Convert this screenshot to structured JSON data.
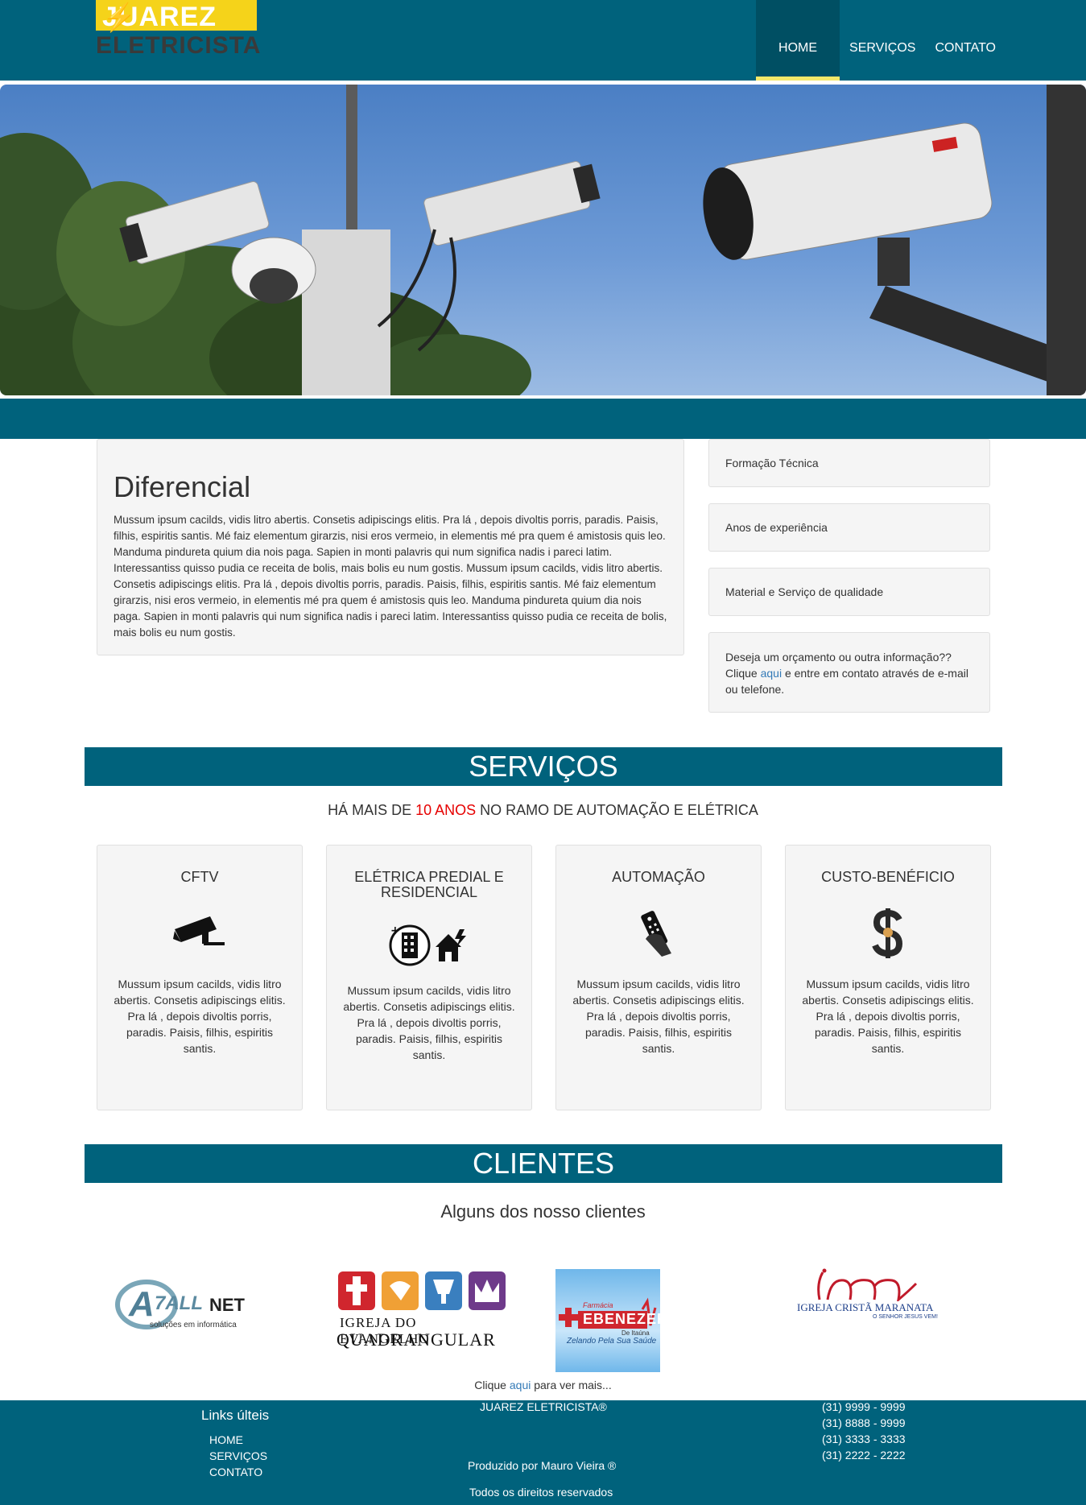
{
  "header": {
    "logo_top": "JUAREZ",
    "logo_bottom": "ELETRICISTA",
    "nav": [
      "HOME",
      "SERVIÇOS",
      "CONTATO"
    ]
  },
  "diferencial": {
    "title": "Diferencial",
    "text": "Mussum ipsum cacilds, vidis litro abertis. Consetis adipiscings elitis. Pra lá , depois divoltis porris, paradis. Paisis, filhis, espiritis santis. Mé faiz elementum girarzis, nisi eros vermeio, in elementis mé pra quem é amistosis quis leo. Manduma pindureta quium dia nois paga. Sapien in monti palavris qui num significa nadis i pareci latim. Interessantiss quisso pudia ce receita de bolis, mais bolis eu num gostis. Mussum ipsum cacilds, vidis litro abertis. Consetis adipiscings elitis. Pra lá , depois divoltis porris, paradis. Paisis, filhis, espiritis santis. Mé faiz elementum girarzis, nisi eros vermeio, in elementis mé pra quem é amistosis quis leo. Manduma pindureta quium dia nois paga. Sapien in monti palavris qui num significa nadis i pareci latim. Interessantiss quisso pudia ce receita de bolis, mais bolis eu num gostis."
  },
  "side": {
    "items": [
      "Formação Técnica",
      "Anos de experiência",
      "Material e Serviço de qualidade"
    ],
    "contact_pre": "Deseja um orçamento ou outra informação?? Clique ",
    "contact_link": "aqui",
    "contact_post": " e entre em contato através de e-mail ou telefone."
  },
  "servicos": {
    "title": "SERVIÇOS",
    "sub_pre": "HÁ MAIS DE ",
    "sub_highlight": "10 ANOS",
    "sub_post": " NO RAMO DE AUTOMAÇÃO E ELÉTRICA",
    "highlight_color": "#e60000",
    "cards": [
      {
        "title": "CFTV",
        "icon": "cctv-camera-icon",
        "text": "Mussum ipsum cacilds, vidis litro abertis. Consetis adipiscings elitis. Pra lá , depois divoltis porris, paradis. Paisis, filhis, espiritis santis."
      },
      {
        "title": "ELÉTRICA PREDIAL E RESIDENCIAL",
        "icon": "building-house-icon",
        "text": "Mussum ipsum cacilds, vidis litro abertis. Consetis adipiscings elitis. Pra lá , depois divoltis porris, paradis. Paisis, filhis, espiritis santis."
      },
      {
        "title": "AUTOMAÇÃO",
        "icon": "remote-control-icon",
        "text": "Mussum ipsum cacilds, vidis litro abertis. Consetis adipiscings elitis. Pra lá , depois divoltis porris, paradis. Paisis, filhis, espiritis santis."
      },
      {
        "title": "CUSTO-BENÉFICIO",
        "icon": "dollar-icon",
        "text": "Mussum ipsum cacilds, vidis litro abertis. Consetis adipiscings elitis. Pra lá , depois divoltis porris, paradis. Paisis, filhis, espiritis santis."
      }
    ]
  },
  "clientes": {
    "title": "CLIENTES",
    "sub": "Alguns dos nosso clientes",
    "logos": [
      {
        "name": "A7ALLNET",
        "tagline": "soluções em informática"
      },
      {
        "line1": "IGREJA DO EVANGELHO",
        "line2": "QUADRANGULAR"
      },
      {
        "line1": "Farmácia",
        "line2": "EBENEZER",
        "line3": "De Itaúna",
        "line4": "Zelando Pela Sua Saúde"
      },
      {
        "line1": "IGREJA CRISTÃ MARANATA",
        "line2": "O SENHOR JESUS VEM!"
      }
    ],
    "more_pre": "Clique ",
    "more_link": "aqui",
    "more_post": " para ver mais..."
  },
  "footer": {
    "links_title": "Links últeis",
    "links": [
      "HOME",
      "SERVIÇOS",
      "CONTATO"
    ],
    "company": "JUAREZ ELETRICISTA®",
    "produced": "Produzido por Mauro Vieira ®",
    "rights": "Todos os direitos reservados",
    "phones": [
      "(31) 9999 - 9999",
      "(31) 8888 - 9999",
      "(31) 3333 - 3333",
      "(31) 2222 - 2222"
    ]
  },
  "colors": {
    "primary": "#00627c",
    "accent_yellow": "#f5d31a",
    "box_bg": "#f5f5f5"
  }
}
